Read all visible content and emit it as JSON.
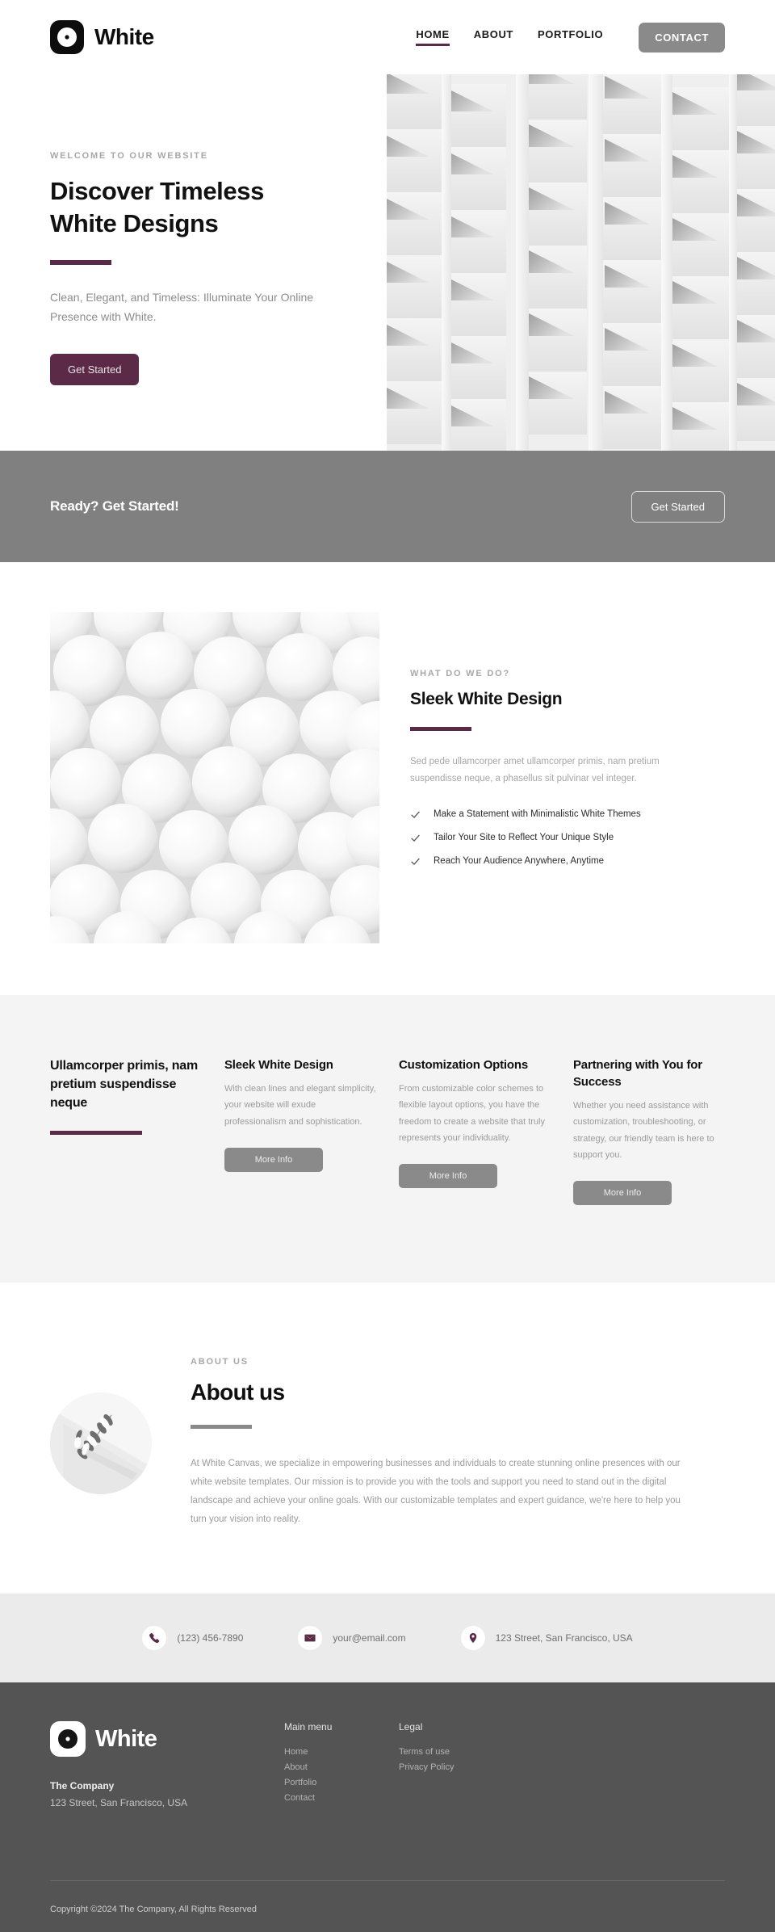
{
  "colors": {
    "accent": "#5b2a47",
    "gray_band": "#808080",
    "features_bg": "#f4f4f4",
    "contactbar_bg": "#ebebeb",
    "footer_bg": "#545454",
    "button_gray": "#8a8a8a"
  },
  "header": {
    "brand_name": "White",
    "logo_icon": "pinwheel-logo-icon",
    "nav": [
      {
        "label": "HOME",
        "active": true
      },
      {
        "label": "ABOUT",
        "active": false
      },
      {
        "label": "PORTFOLIO",
        "active": false
      }
    ],
    "contact_button": "CONTACT"
  },
  "hero": {
    "eyebrow": "WELCOME TO OUR WEBSITE",
    "title_line1": "Discover Timeless",
    "title_line2": "White Designs",
    "subtitle": "Clean, Elegant, and Timeless: Illuminate Your Online Presence with White.",
    "cta_label": "Get Started",
    "image_alt": "white-architectural-facade-image"
  },
  "cta_band": {
    "text": "Ready? Get Started!",
    "button_label": "Get Started"
  },
  "what_we_do": {
    "image_alt": "white-spheres-image",
    "eyebrow": "WHAT DO WE DO?",
    "title": "Sleek White Design",
    "description": "Sed pede ullamcorper amet ullamcorper primis, nam pretium suspendisse neque, a phasellus sit pulvinar vel integer.",
    "checklist": [
      "Make a Statement with Minimalistic White Themes",
      "Tailor Your Site to Reflect Your Unique Style",
      "Reach Your Audience Anywhere, Anytime"
    ]
  },
  "features": {
    "lead_title": "Ullamcorper primis, nam pretium suspendisse neque",
    "cards": [
      {
        "title": "Sleek White Design",
        "body": "With clean lines and elegant simplicity, your website will exude professionalism and sophistication.",
        "button_label": "More Info"
      },
      {
        "title": "Customization Options",
        "body": "From customizable color schemes to flexible layout options, you have the freedom to create a website that truly represents your individuality.",
        "button_label": "More Info"
      },
      {
        "title": "Partnering with You for Success",
        "body": "Whether you need assistance with customization, troubleshooting, or strategy, our friendly team is here to support you.",
        "button_label": "More Info"
      }
    ]
  },
  "about": {
    "image_alt": "white-branch-shadow-image",
    "eyebrow": "ABOUT US",
    "title": "About us",
    "body": "At White Canvas, we specialize in empowering businesses and individuals to create stunning online presences with our white website templates. Our mission is to provide you with the tools and support you need to stand out in the digital landscape and achieve your online goals. With our customizable templates and expert guidance, we're here to help you turn your vision into reality."
  },
  "contact_bar": {
    "items": [
      {
        "icon": "phone-icon",
        "text": "(123) 456-7890"
      },
      {
        "icon": "envelope-icon",
        "text": "your@email.com"
      },
      {
        "icon": "map-pin-icon",
        "text": "123 Street, San Francisco, USA"
      }
    ]
  },
  "footer": {
    "brand_name": "White",
    "logo_icon": "pinwheel-logo-icon",
    "company_label": "The Company",
    "company_address": "123 Street, San Francisco, USA",
    "columns": [
      {
        "title": "Main menu",
        "links": [
          "Home",
          "About",
          "Portfolio",
          "Contact"
        ]
      },
      {
        "title": "Legal",
        "links": [
          "Terms of use",
          "Privacy Policy"
        ]
      }
    ],
    "copyright": "Copyright ©2024 The Company, All Rights Reserved"
  }
}
